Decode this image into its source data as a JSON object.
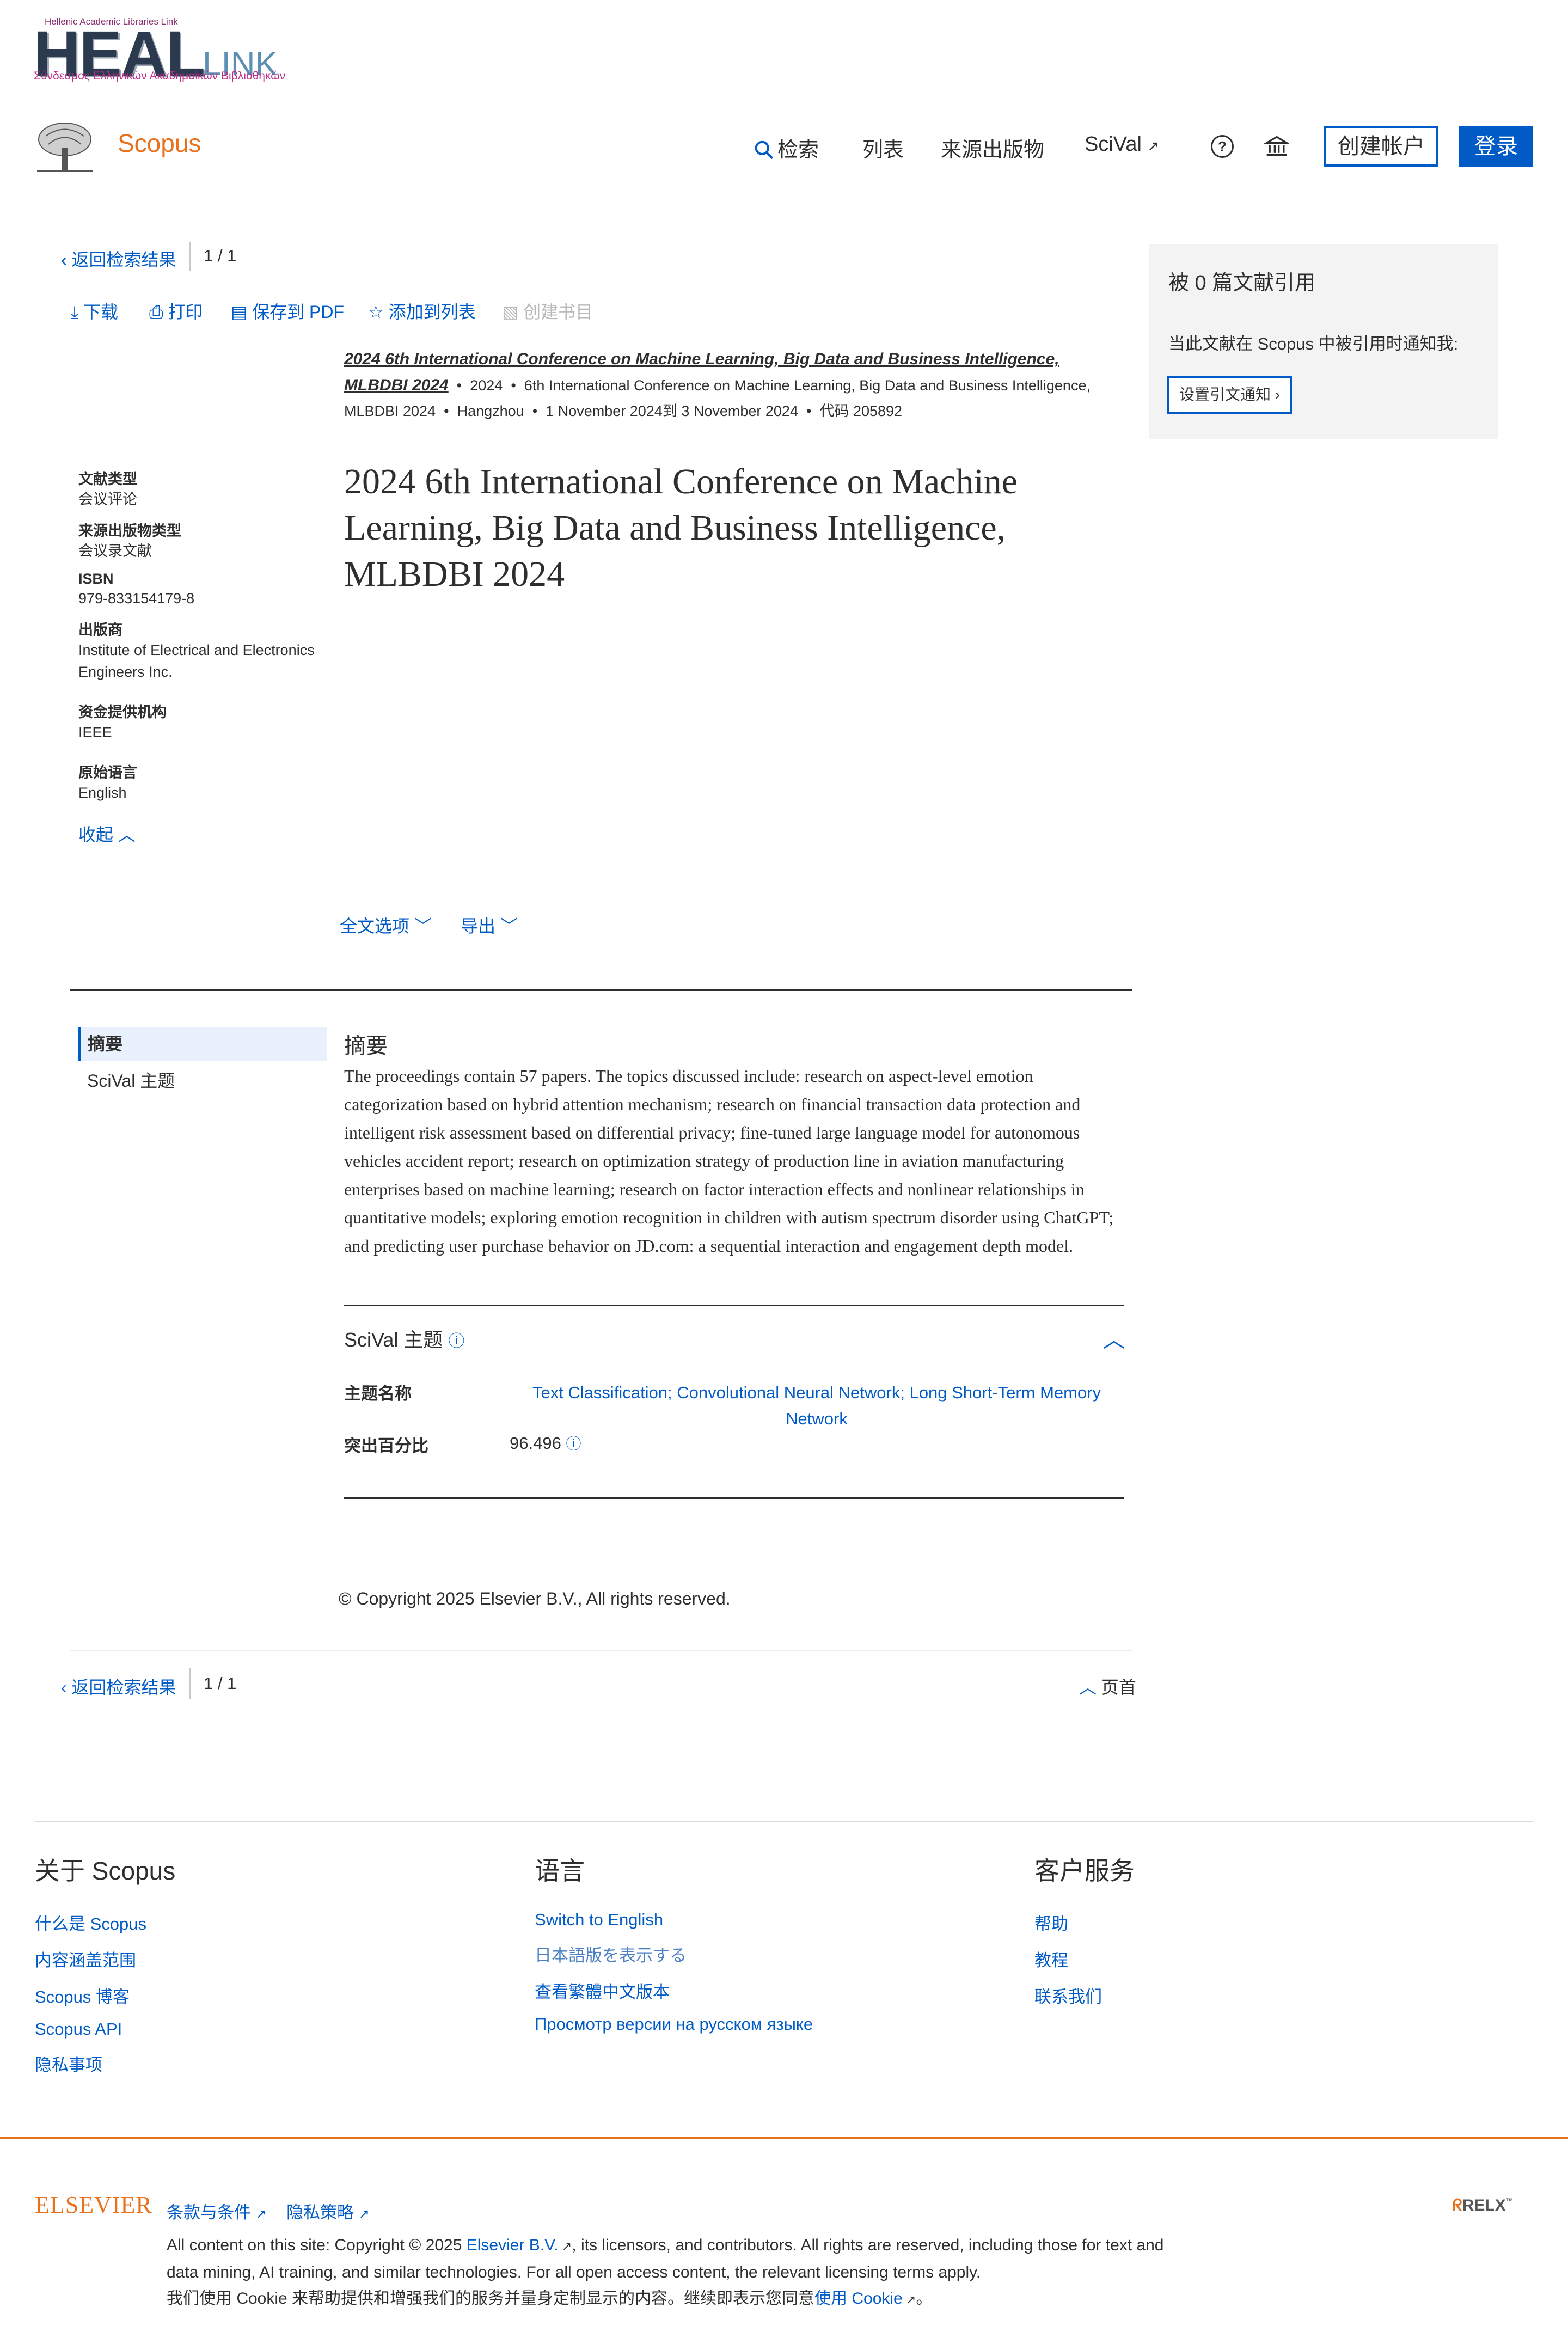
{
  "brand_logo": {
    "small_text": "Hellenic Academic Libraries Link",
    "big_text": "HEAL",
    "link_text": "LINK",
    "greek_text": "Σύνδεσμος Ελληνικών Ακαδημαϊκών Βιβλιοθηκών"
  },
  "header": {
    "brand": "Scopus",
    "nav": {
      "search": "检索",
      "lists": "列表",
      "sources": "来源出版物",
      "scival": "SciVal"
    },
    "help_symbol": "?",
    "create_account": "创建帐户",
    "login": "登录"
  },
  "doc_nav": {
    "back": "返回检索结果",
    "pagination": "1 / 1"
  },
  "toolbar": {
    "download": "下载",
    "print": "打印",
    "save_pdf": "保存到 PDF",
    "add_to_list": "添加到列表",
    "create_bib": "创建书目"
  },
  "source": {
    "title": "2024 6th International Conference on Machine Learning, Big Data and Business Intelligence, MLBDBI 2024",
    "year": "2024",
    "conf_name": "6th International Conference on Machine Learning, Big Data and Business Intelligence, MLBDBI 2024",
    "location": "Hangzhou",
    "dates": "1 November 2024到 3 November 2024",
    "code": "代码 205892"
  },
  "document": {
    "title": "2024 6th International Conference on Machine Learning, Big Data and Business Intelligence, MLBDBI 2024"
  },
  "metadata": {
    "doc_type_label": "文献类型",
    "doc_type": "会议评论",
    "source_type_label": "来源出版物类型",
    "source_type": "会议录文献",
    "isbn_label": "ISBN",
    "isbn": "979-833154179-8",
    "publisher_label": "出版商",
    "publisher": "Institute of Electrical and Electronics Engineers Inc.",
    "funding_label": "资金提供机构",
    "funding": "IEEE",
    "language_label": "原始语言",
    "language": "English",
    "collapse": "收起"
  },
  "actions": {
    "fulltext": "全文选项",
    "export": "导出"
  },
  "citations": {
    "title": "被 0 篇文献引用",
    "notify_text": "当此文献在 Scopus 中被引用时通知我:",
    "alert_button": "设置引文通知"
  },
  "side_nav": {
    "abstract": "摘要",
    "scival": "SciVal 主题"
  },
  "abstract": {
    "heading": "摘要",
    "text": "The proceedings contain 57 papers. The topics discussed include: research on aspect-level emotion categorization based on hybrid attention mechanism; research on financial transaction data protection and intelligent risk assessment based on differential privacy; fine-tuned large language model for autonomous vehicles accident report; research on optimization strategy of production line in aviation manufacturing enterprises based on machine learning; research on factor interaction effects and nonlinear relationships in quantitative models; exploring emotion recognition in children with autism spectrum disorder using ChatGPT; and predicting user purchase behavior on JD.com: a sequential interaction and engagement depth model."
  },
  "scival": {
    "heading": "SciVal 主题",
    "topic_label": "主题名称",
    "topic_value": "Text Classification; Convolutional Neural Network; Long Short-Term Memory Network",
    "prominence_label": "突出百分比",
    "prominence_value": "96.496"
  },
  "copyright": "© Copyright 2025 Elsevier B.V., All rights reserved.",
  "bottom_nav": {
    "back": "返回检索结果",
    "pagination": "1 / 1",
    "top": "页首"
  },
  "footer": {
    "about": {
      "heading": "关于 Scopus",
      "links": [
        "什么是 Scopus",
        "内容涵盖范围",
        "Scopus 博客",
        "Scopus API",
        "隐私事项"
      ]
    },
    "language": {
      "heading": "语言",
      "links": [
        "Switch to English",
        "日本語版を表示する",
        "查看繁體中文版本",
        "Просмотр версии на русском языке"
      ]
    },
    "service": {
      "heading": "客户服务",
      "links": [
        "帮助",
        "教程",
        "联系我们"
      ]
    },
    "elsevier": "ELSEVIER",
    "terms": "条款与条件",
    "privacy": "隐私策略",
    "legal_1": "All content on this site: Copyright © 2025 ",
    "legal_elsevier": "Elsevier B.V.",
    "legal_2": ", its licensors, and contributors. All rights are reserved, including those for text and data mining, AI training, and similar technologies. For all open access content, the relevant licensing terms apply.",
    "cookie_1": "我们使用 Cookie 来帮助提供和增强我们的服务并量身定制显示的内容。继续即表示您同意",
    "cookie_link": "使用 Cookie",
    "cookie_end": "。",
    "relx": "RELX"
  }
}
